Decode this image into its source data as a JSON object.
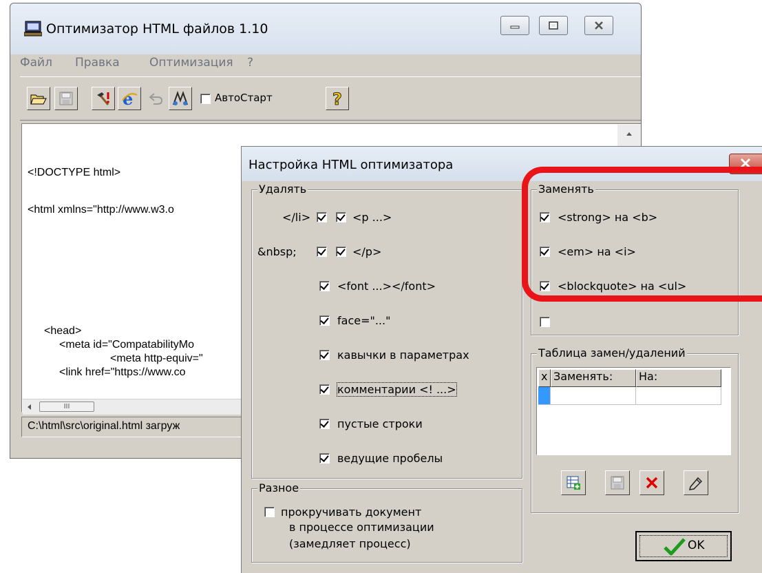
{
  "main_window": {
    "title": "Оптимизатор HTML файлов 1.10",
    "menu": [
      "Файл",
      "Правка",
      "Оптимизация",
      "?"
    ],
    "toolbar": {
      "autostart_label": "АвтоСтарт",
      "autostart_checked": false
    },
    "editor_lines": [
      "<!DOCTYPE html>",
      "<html xmlns=\"http://www.w3.o",
      "<head>",
      "<meta id=\"CompatabilityMo",
      "<meta http-equiv=\"",
      "<link href=\"https://www.co"
    ],
    "scroll_thumb_glyph": "III",
    "status": "C:\\html\\src\\original.html загруж"
  },
  "dialog": {
    "title": "Настройка HTML оптимизатора",
    "delete_group": {
      "label": "Удалять",
      "items": [
        {
          "label": "</li>",
          "checked": true
        },
        {
          "label": "<p ...>",
          "checked": true
        },
        {
          "label": "&nbsp;",
          "checked": true
        },
        {
          "label": "</p>",
          "checked": true
        },
        {
          "label": "<font ...></font>",
          "checked": true
        },
        {
          "label": "face=\"...\"",
          "checked": true
        },
        {
          "label": "кавычки в параметрах",
          "checked": true
        },
        {
          "label": "комментарии <! ...>",
          "checked": true
        },
        {
          "label": "пустые строки",
          "checked": true
        },
        {
          "label": "ведущие пробелы",
          "checked": true
        }
      ]
    },
    "replace_group": {
      "label": "Заменять",
      "items": [
        {
          "label": "<strong> на <b>",
          "checked": true
        },
        {
          "label": "<em> на <i>",
          "checked": true
        },
        {
          "label": "<blockquote> на <ul>",
          "checked": true
        },
        {
          "label": "",
          "checked": false
        }
      ]
    },
    "misc_group": {
      "label": "Разное",
      "scroll_checked": false,
      "scroll_label_lines": [
        "прокручивать документ",
        "в процессе оптимизации",
        "(замедляет процесс)"
      ]
    },
    "table_group": {
      "label": "Таблица замен/удалений",
      "columns": [
        "x",
        "Заменять:",
        "На:"
      ]
    },
    "ok_label": "OK"
  },
  "colors": {
    "highlight": "#e8141a",
    "selection": "#3399ff",
    "window_bg": "#d4d0c8"
  }
}
